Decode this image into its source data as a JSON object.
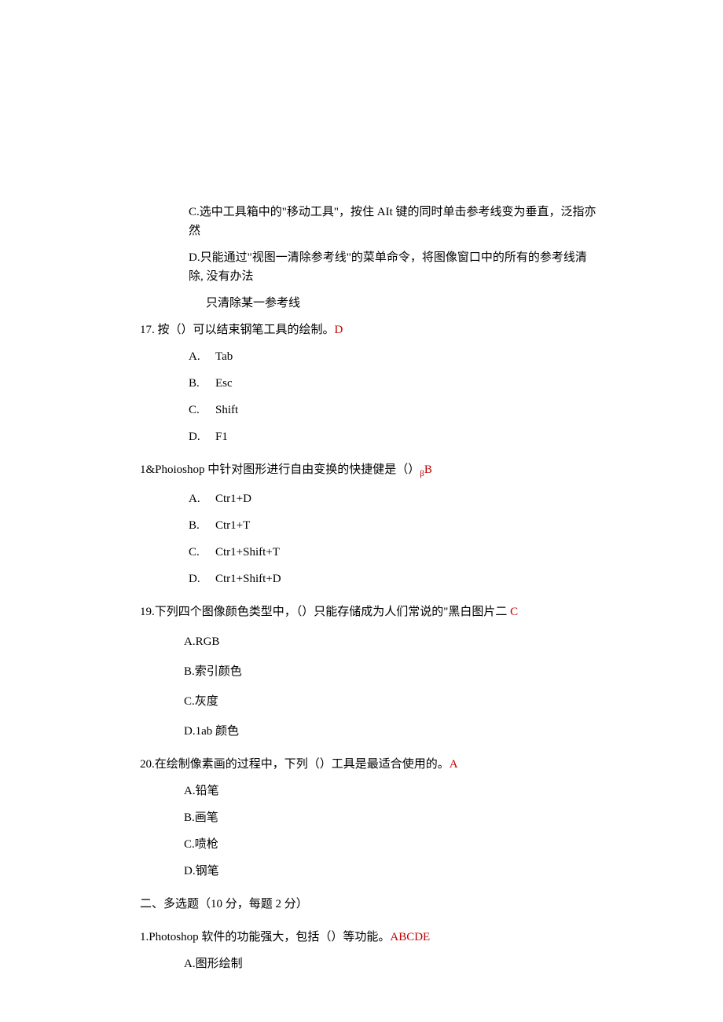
{
  "q16": {
    "optC": "C.选中工具箱中的\"移动工具\"，按住 AIt 键的同时单击参考线变为垂直，泛指亦然",
    "optD_l1": "D.只能通过\"视图一清除参考线\"的菜单命令，将图像窗口中的所有的参考线清除, 没有办法",
    "optD_l2": "只清除某一参考线"
  },
  "q17": {
    "stem": "17. 按（）可以结束钢笔工具的绘制。",
    "ans": "D",
    "A": {
      "l": "A.",
      "t": "Tab"
    },
    "B": {
      "l": "B.",
      "t": "Esc"
    },
    "C": {
      "l": "C.",
      "t": "Shift"
    },
    "D": {
      "l": "D.",
      "t": "F1"
    }
  },
  "q18": {
    "stem_a": "1&Phoioshop 中针对图形进行自由变换的快捷健是（）",
    "sub": "β",
    "ans": "B",
    "A": {
      "l": "A.",
      "t": "Ctr1+D"
    },
    "B": {
      "l": "B.",
      "t": "Ctr1+T"
    },
    "C": {
      "l": "C.",
      "t": "Ctr1+Shift+T"
    },
    "D": {
      "l": "D.",
      "t": "Ctr1+Shift+D"
    }
  },
  "q19": {
    "stem": "19.下列四个图像颜色类型中，（）只能存储成为人们常说的\"黑白图片二 ",
    "ans": "C",
    "A": "A.RGB",
    "B": "B.索引颜色",
    "C": "C.灰度",
    "D": "D.1ab 颜色"
  },
  "q20": {
    "stem": "20.在绘制像素画的过程中，下列（）工具是最适合使用的。",
    "ans": "A",
    "A": "A.铅笔",
    "B": "B.画笔",
    "C": "C.喷枪",
    "D": "D.钢笔"
  },
  "sec2": {
    "title": "二、多选题（10 分，每题 2 分）"
  },
  "mq1": {
    "stem": "1.Photoshop 软件的功能强大，包括（）等功能。",
    "ans": "ABCDE",
    "A": "A.图形绘制"
  }
}
